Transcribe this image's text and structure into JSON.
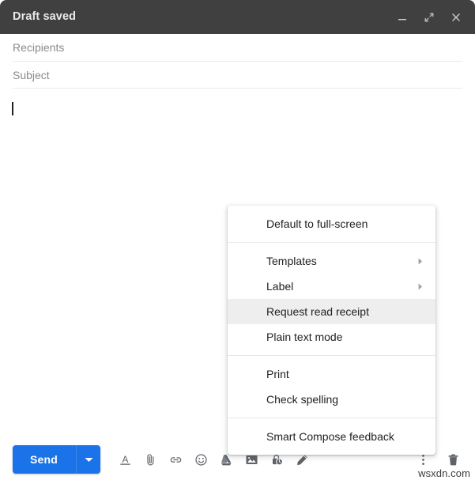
{
  "window": {
    "title": "Draft saved",
    "controls": [
      {
        "name": "minimize",
        "label": "Minimize"
      },
      {
        "name": "expand",
        "label": "Full screen"
      },
      {
        "name": "close",
        "label": "Save & close"
      }
    ]
  },
  "fields": {
    "recipients_placeholder": "Recipients",
    "subject_placeholder": "Subject",
    "body_value": ""
  },
  "toolbar": {
    "send_label": "Send",
    "send_dropdown_icon": "chevron-down-icon",
    "icons": [
      {
        "name": "format-text-icon",
        "label": "Formatting options"
      },
      {
        "name": "attach-file-icon",
        "label": "Attach files"
      },
      {
        "name": "insert-link-icon",
        "label": "Insert link"
      },
      {
        "name": "insert-emoji-icon",
        "label": "Insert emoji"
      },
      {
        "name": "insert-drive-icon",
        "label": "Insert files using Drive"
      },
      {
        "name": "insert-photo-icon",
        "label": "Insert photo"
      },
      {
        "name": "confidential-mode-icon",
        "label": "Toggle confidential mode"
      },
      {
        "name": "insert-signature-icon",
        "label": "Insert signature"
      }
    ],
    "more_options_icon": "more-vert-icon",
    "discard_icon": "trash-icon"
  },
  "menu": {
    "groups": [
      {
        "items": [
          {
            "label": "Default to full-screen",
            "submenu": false,
            "highlighted": false
          }
        ]
      },
      {
        "items": [
          {
            "label": "Templates",
            "submenu": true,
            "highlighted": false
          },
          {
            "label": "Label",
            "submenu": true,
            "highlighted": false
          },
          {
            "label": "Request read receipt",
            "submenu": false,
            "highlighted": true
          },
          {
            "label": "Plain text mode",
            "submenu": false,
            "highlighted": false
          }
        ]
      },
      {
        "items": [
          {
            "label": "Print",
            "submenu": false,
            "highlighted": false
          },
          {
            "label": "Check spelling",
            "submenu": false,
            "highlighted": false
          }
        ]
      },
      {
        "items": [
          {
            "label": "Smart Compose feedback",
            "submenu": false,
            "highlighted": false
          }
        ]
      }
    ]
  },
  "watermark": {
    "text": "wsxdn.com"
  },
  "colors": {
    "header_bg": "#404040",
    "send_blue": "#1a73e8",
    "menu_highlight": "#eeeeee",
    "icon_gray": "#5f6368"
  }
}
